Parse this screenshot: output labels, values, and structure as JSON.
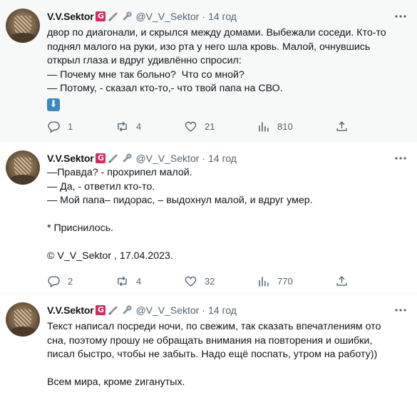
{
  "tweets": [
    {
      "author": {
        "name": "V.V.Sektor",
        "handle": "@V_V_Sektor",
        "time": "14 год"
      },
      "lines": [
        "двор по диагонали, и скрылся между домами. Выбежали соседи. Кто-то",
        "поднял малого на руки, изо рта у него шла кровь. Малой, очнувшись",
        "открыл глаза и вдруг удивлённо спросил:",
        "— Почему мне так больно?  Что со мной?",
        "— Потому, - сказал кто-то,- что твой папа на СВО."
      ],
      "emoji": "⬇",
      "stats": {
        "replies": "1",
        "retweets": "4",
        "likes": "21",
        "views": "810"
      }
    },
    {
      "author": {
        "name": "V.V.Sektor",
        "handle": "@V_V_Sektor",
        "time": "14 год"
      },
      "lines": [
        "—Правда? - прохрипел малой.",
        "— Да, - ответил кто-то.",
        "— Мой папа– пидорас, – выдохнул малой, и вдруг умер.",
        "",
        "* Приснилось.",
        "",
        "© V_V_Sektor , 17.04.2023."
      ],
      "stats": {
        "replies": "2",
        "retweets": "4",
        "likes": "32",
        "views": "770"
      }
    },
    {
      "author": {
        "name": "V.V.Sektor",
        "handle": "@V_V_Sektor",
        "time": "14 год"
      },
      "lines": [
        "Текст написал посреди ночи, по свежим, так сказать впечатлениям ото",
        "сна, поэтому прошу не обращать внимания на повторения и ошибки,",
        "писал быстро, чтобы не забыть. Надо ещё поспать, утром на работу))",
        "",
        "Всем мира, кроме zиганутых."
      ]
    }
  ],
  "badge_letter": "G",
  "separator": "·",
  "colors": {
    "text": "#0f1419",
    "muted": "#536471",
    "badge": "#e0245e",
    "hover_bg": "#f7f9f9"
  },
  "icons": [
    "more-icon",
    "reply-icon",
    "retweet-icon",
    "like-icon",
    "views-icon",
    "share-icon",
    "syringe-icon",
    "microphone-icon"
  ]
}
